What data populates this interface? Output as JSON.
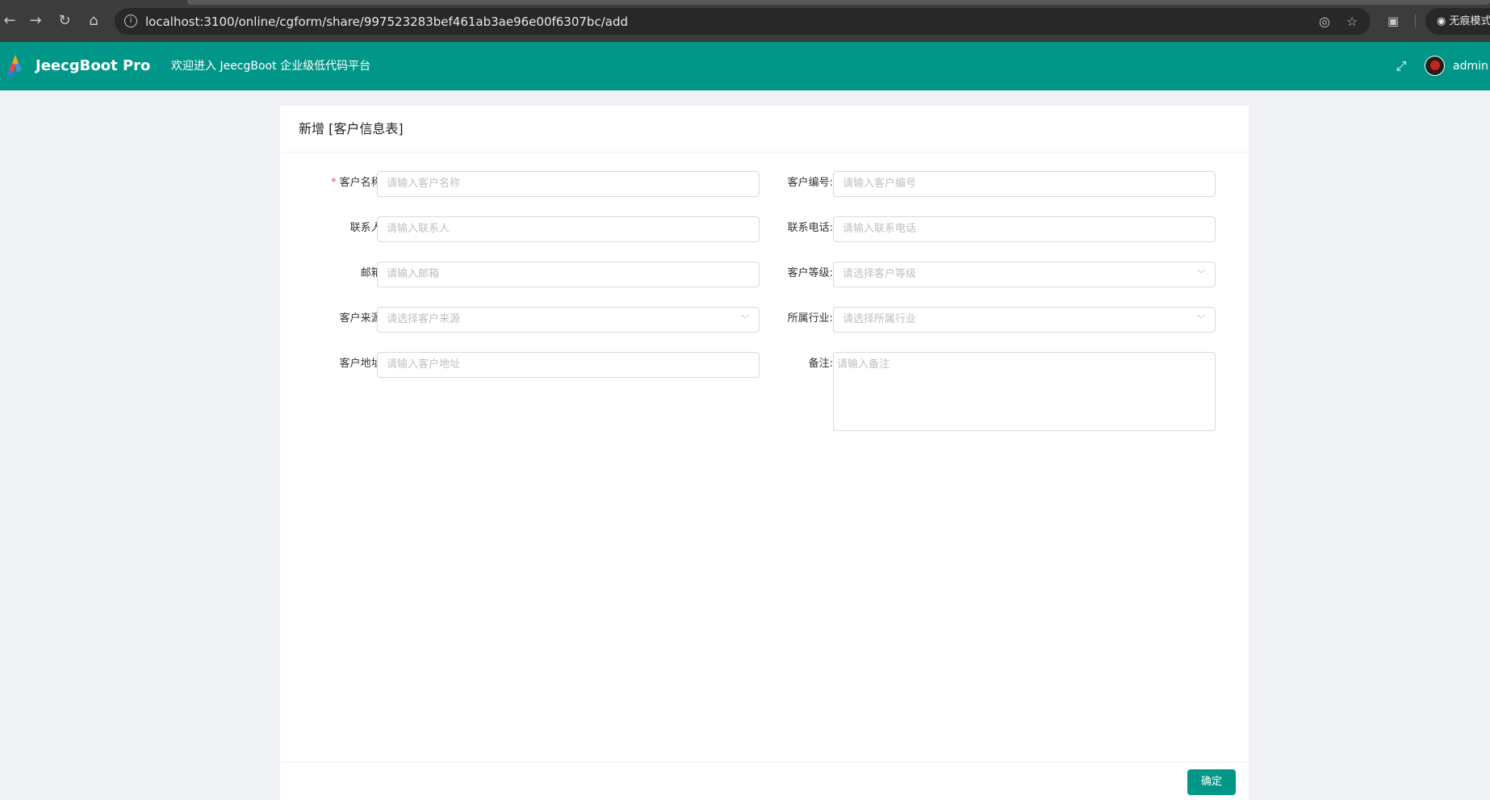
{
  "browser": {
    "url": "localhost:3100/online/cgform/share/997523283bef461ab3ae96e00f6307bc/add",
    "incognito_label": "无痕模式"
  },
  "header": {
    "brand": "JeecgBoot Pro",
    "welcome": "欢迎进入 JeecgBoot 企业级低代码平台",
    "username": "admin"
  },
  "form": {
    "title": "新增 [客户信息表]",
    "required_mark": "*",
    "fields": [
      {
        "label": "客户名称:",
        "placeholder": "请输入客户名称",
        "required": true,
        "type": "input"
      },
      {
        "label": "客户编号:",
        "placeholder": "请输入客户编号",
        "type": "input"
      },
      {
        "label": "联系人:",
        "placeholder": "请输入联系人",
        "type": "input"
      },
      {
        "label": "联系电话:",
        "placeholder": "请输入联系电话",
        "type": "input"
      },
      {
        "label": "邮箱:",
        "placeholder": "请输入邮箱",
        "type": "input"
      },
      {
        "label": "客户等级:",
        "placeholder": "请选择客户等级",
        "type": "select"
      },
      {
        "label": "客户来源:",
        "placeholder": "请选择客户来源",
        "type": "select"
      },
      {
        "label": "所属行业:",
        "placeholder": "请选择所属行业",
        "type": "select"
      },
      {
        "label": "客户地址:",
        "placeholder": "请输入客户地址",
        "type": "input"
      },
      {
        "label": "备注:",
        "placeholder": "请输入备注",
        "type": "textarea"
      }
    ],
    "confirm_label": "确定"
  },
  "colors": {
    "primary": "#019788",
    "required": "#ff4d4f"
  }
}
